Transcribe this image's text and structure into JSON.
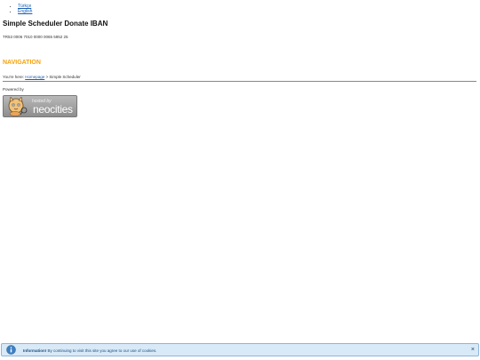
{
  "languages": [
    "Türkçe",
    "English"
  ],
  "page_title": "Simple Scheduler Donate IBAN",
  "iban": "TR53 0006 7010 0000 0065 5952 25",
  "nav": {
    "heading": "NAVIGATION",
    "prefix": "You're here:",
    "home_link": "Homepage",
    "separator": ">",
    "current": "Simple Scheduler"
  },
  "powered_by": "Powered by",
  "badge": {
    "hosted": "hosted by",
    "brand": "neocities"
  },
  "cookie": {
    "title": "Information!",
    "text": "By continuing to visit this site you agree to our use of cookies.",
    "close": "×"
  },
  "colors": {
    "accent": "#f5a30c",
    "link": "#1a5fb4",
    "cookie_bg": "#d8e9f7"
  }
}
